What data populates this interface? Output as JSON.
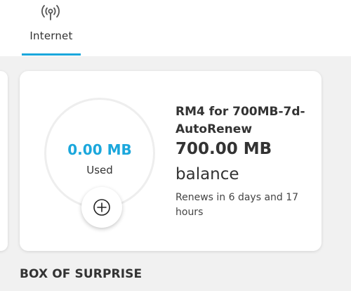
{
  "tabs": [
    {
      "label": "Internet",
      "icon": "broadcast-icon",
      "active": true
    }
  ],
  "plan_card": {
    "usage_value": "0.00 MB",
    "usage_label": "Used",
    "plan_name": "RM4 for 700MB-7d-AutoRenew",
    "balance_value": "700.00 MB",
    "balance_label": "balance",
    "renew_text": "Renews in 6 days and 17 hours",
    "add_icon": "plus-circle-icon"
  },
  "section": {
    "title": "BOX OF SURPRISE"
  },
  "colors": {
    "accent": "#1ba7dc",
    "background": "#f1f1f1",
    "card": "#ffffff",
    "text": "#333333"
  }
}
